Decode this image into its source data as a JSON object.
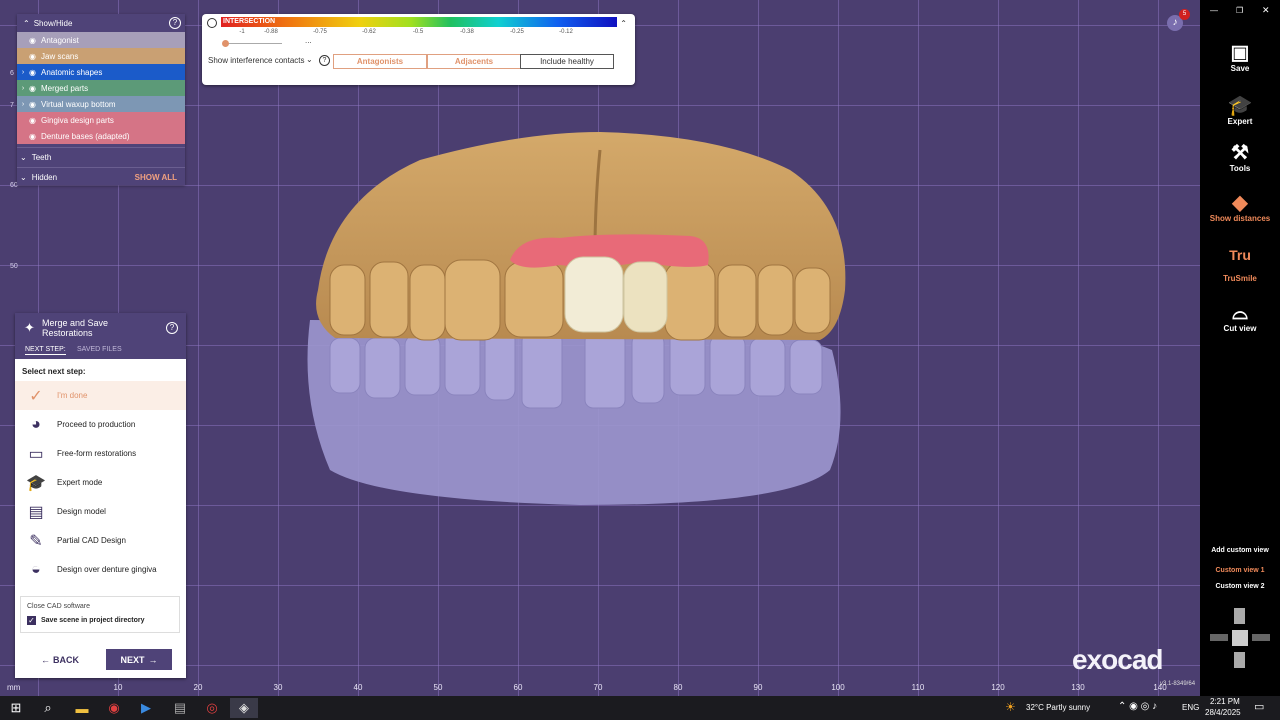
{
  "tree": {
    "header": "Show/Hide",
    "items": [
      {
        "label": "Antagonist",
        "bg": "#a79fb9",
        "expand": false
      },
      {
        "label": "Jaw scans",
        "bg": "#c9a073",
        "expand": false
      },
      {
        "label": "Anatomic shapes",
        "bg": "#1b5bc9",
        "expand": true
      },
      {
        "label": "Merged parts",
        "bg": "#5c9a78",
        "expand": true
      },
      {
        "label": "Virtual waxup bottom",
        "bg": "#7d97b4",
        "expand": true
      },
      {
        "label": "Gingiva design parts",
        "bg": "#d57486",
        "expand": false
      },
      {
        "label": "Denture bases (adapted)",
        "bg": "#d57486",
        "expand": false
      }
    ],
    "teeth": "Teeth",
    "hidden": "Hidden",
    "show_all": "SHOW ALL"
  },
  "colorbar": {
    "title": "INTERSECTION",
    "ticks": [
      "-1",
      "-0.88",
      "-0.75",
      "-0.62",
      "-0.5",
      "-0.38",
      "-0.25",
      "-0.12"
    ],
    "ellipsis": "...",
    "show_contacts": "Show interference contacts",
    "btn_antagonists": "Antagonists",
    "btn_adjacents": "Adjacents",
    "btn_include_healthy": "Include healthy",
    "slider_value": 0.0
  },
  "merge": {
    "title": "Merge and Save Restorations",
    "tab_next": "NEXT STEP:",
    "tab_saved": "SAVED FILES",
    "select": "Select next step:",
    "steps": [
      {
        "label": "I'm done",
        "icon": "checkmark-icon"
      },
      {
        "label": "Proceed to production",
        "icon": "production-icon"
      },
      {
        "label": "Free-form restorations",
        "icon": "freeform-icon"
      },
      {
        "label": "Expert mode",
        "icon": "graduation-cap-icon"
      },
      {
        "label": "Design model",
        "icon": "design-model-icon"
      },
      {
        "label": "Partial CAD Design",
        "icon": "partial-cad-icon"
      },
      {
        "label": "Design over denture gingiva",
        "icon": "denture-gingiva-icon"
      }
    ],
    "close_cad": "Close CAD software",
    "save_scene": "Save scene in project directory",
    "back": "BACK",
    "next": "NEXT"
  },
  "sidebar": {
    "notification_count": "5",
    "buttons": [
      {
        "label": "Save",
        "icon": "save-icon"
      },
      {
        "label": "Expert",
        "icon": "graduation-cap-icon"
      },
      {
        "label": "Tools",
        "icon": "tools-icon"
      },
      {
        "label": "Show distances",
        "icon": "distances-icon"
      },
      {
        "label": "TruSmile",
        "icon": "trusmile-icon"
      },
      {
        "label": "Cut view",
        "icon": "cut-view-icon"
      }
    ],
    "tru_text": "Tru",
    "add_custom_view": "Add custom view",
    "custom_view_1": "Custom view 1",
    "custom_view_2": "Custom view 2",
    "brand": "exocad",
    "version": "v3.1-8349/64"
  },
  "ruler": {
    "mm": "mm",
    "ticks": [
      "10",
      "20",
      "30",
      "40",
      "50",
      "60",
      "70",
      "80",
      "90",
      "100",
      "110",
      "120",
      "130",
      "140"
    ],
    "vticks": [
      "60",
      "50",
      "7",
      "6"
    ]
  },
  "taskbar": {
    "weather": "32°C  Partly sunny",
    "lang": "ENG",
    "time": "2:21 PM",
    "date": "28/4/2025"
  },
  "colors": {
    "accent": "#e0926a",
    "panel": "#4f4378",
    "viewport": "#4b3e70"
  }
}
